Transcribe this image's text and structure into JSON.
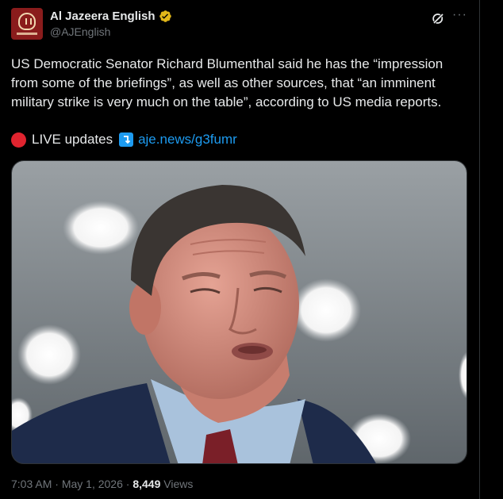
{
  "account": {
    "display_name": "Al Jazeera English",
    "handle": "@AJEnglish"
  },
  "tweet": {
    "text": "US Democratic Senator Richard Blumenthal said he has the “impression from some of the briefings”, as well as other sources, that “an imminent military strike is very much on the table”, according to US media reports.",
    "live_label": "LIVE updates",
    "link_text": "aje.news/g3fumr"
  },
  "meta": {
    "time": "7:03 AM",
    "separator": "·",
    "date": "May 1, 2026",
    "views_count": "8,449",
    "views_label": "Views"
  },
  "colors": {
    "background": "#000000",
    "text": "#e7e9ea",
    "muted": "#71767b",
    "link": "#1d9bf0",
    "verified_badge": "#e2b719",
    "live_dot": "#e0242f",
    "avatar_bg": "#8a1c1c"
  },
  "icons": {
    "avatar": "al-jazeera-logo-icon",
    "verified": "gold-verified-badge-icon",
    "grok": "grok-icon",
    "more": "more-options-icon",
    "live": "red-circle-icon",
    "link_arrow": "right-arrow-curving-up-icon"
  }
}
